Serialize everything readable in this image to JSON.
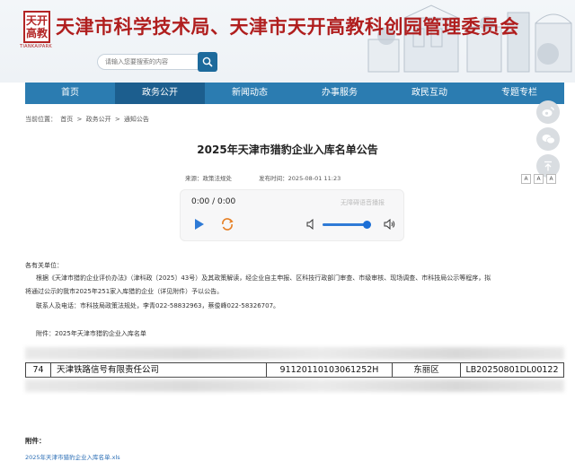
{
  "header": {
    "logo_text": "天开\n高教",
    "logo_sub": "TIANKAIPARK",
    "site_title": "天津市科学技术局、天津市天开高教科创园管理委员会",
    "search_placeholder": "请输入您要搜索的内容",
    "search_icon": "search-icon"
  },
  "nav": {
    "items": [
      "首页",
      "政务公开",
      "新闻动态",
      "办事服务",
      "政民互动",
      "专题专栏"
    ],
    "active_index": 1
  },
  "breadcrumb": {
    "prefix": "当前位置：",
    "items": [
      "首页",
      "政务公开",
      "通知公告"
    ],
    "separator": ">"
  },
  "side_tools": [
    "weibo-icon",
    "wechat-icon",
    "back-to-top-icon"
  ],
  "article": {
    "title": "2025年天津市猎豹企业入库名单公告",
    "source_label": "来源：",
    "source_value": "政策法规处",
    "date_label": "发布时间：",
    "date_value": "2025-08-01 11:23",
    "font_sizer": [
      "A",
      "A",
      "A"
    ]
  },
  "player": {
    "time": "0:00 / 0:00",
    "note": "无障碍语音播报",
    "volume": 0.9,
    "accent_color": "#2e7ad6"
  },
  "body": {
    "salute": "各有关单位：",
    "paragraphs": [
      "根据《天津市猎豹企业评价办法》（津科政〔2025〕43号）及其政策解读，经企业自主申报、区科技行政部门审查、市级审核、现场调查、市科技局公示等程序，拟",
      "将通过公示的我市2025年251家入库猎豹企业（详见附件）予以公告。",
      "联系人及电话：市科技局政策法规处，李青022-58832963，蔡俊峰022-58326707。",
      "附件：2025年天津市猎豹企业入库名单"
    ]
  },
  "table": {
    "row": [
      "74",
      "天津铁路信号有限责任公司",
      "91120110103061252H",
      "东丽区",
      "LB20250801DL00122"
    ]
  },
  "attachments": {
    "label": "附件：",
    "link": "2025年天津市猎豹企业入库名单.xls"
  }
}
